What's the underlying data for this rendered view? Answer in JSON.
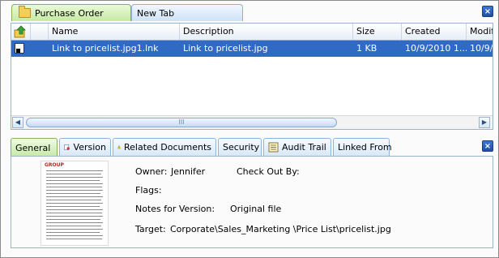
{
  "tabs": [
    {
      "label": "Purchase Order",
      "icon": "folder-icon"
    },
    {
      "label": "New Tab"
    }
  ],
  "close_glyph": "×",
  "list": {
    "columns": [
      "Name",
      "Description",
      "Size",
      "Created",
      "Modif"
    ],
    "rows": [
      {
        "name": "Link to pricelist.jpg1.lnk",
        "description": "Link to pricelist.jpg",
        "size": "1 KB",
        "created": "10/9/2010 1...",
        "modified": "10/9/"
      }
    ],
    "selected_color": "#316ac5",
    "scroll_grip": "III"
  },
  "detail_tabs": [
    "General",
    "Version",
    "Related Documents",
    "Security",
    "Audit Trail",
    "Linked From"
  ],
  "general": {
    "owner_label": "Owner:",
    "owner_value": "Jennifer",
    "checkout_label": "Check Out By:",
    "checkout_value": "",
    "flags_label": "Flags:",
    "flags_value": "",
    "notes_label": "Notes for Version:",
    "notes_value": "Original file",
    "target_label": "Target:",
    "target_value": "Corporate\\Sales_Marketing \\Price List\\pricelist.jpg"
  },
  "thumbnail": {
    "logo_text": "GROUP"
  }
}
